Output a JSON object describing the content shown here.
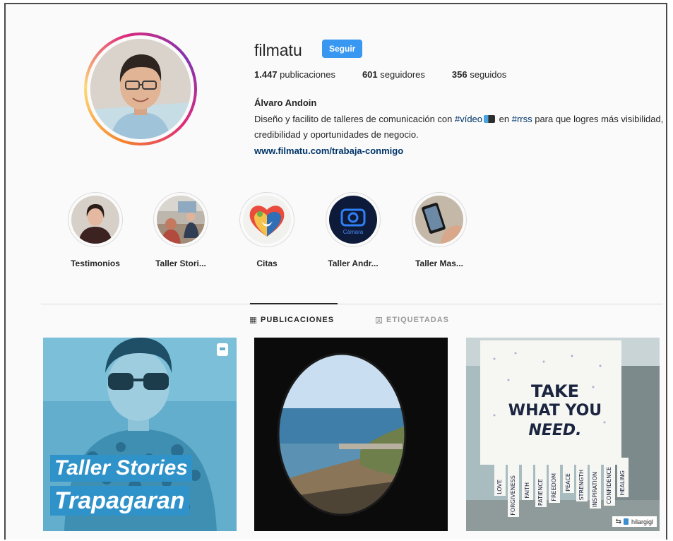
{
  "profile": {
    "username": "filmatu",
    "follow_label": "Seguir",
    "stats": {
      "posts_count": "1.447",
      "posts_label": "publicaciones",
      "followers_count": "601",
      "followers_label": "seguidores",
      "following_count": "356",
      "following_label": "seguidos"
    },
    "full_name": "Álvaro Andoin",
    "bio": {
      "part1": "Diseño y facilito de talleres de comunicación con ",
      "hashtag1": "#vídeo",
      "part2": " en ",
      "hashtag2": "#rrss",
      "part3": " para que logres más visibilidad, credibilidad y oportunidades de negocio."
    },
    "website": "www.filmatu.com/trabaja-conmigo"
  },
  "highlights": [
    {
      "label": "Testimonios"
    },
    {
      "label": "Taller Stori..."
    },
    {
      "label": "Citas"
    },
    {
      "label": "Taller Andr..."
    },
    {
      "label": "Taller Mas..."
    }
  ],
  "tabs": {
    "publicaciones": "PUBLICACIONES",
    "etiquetadas": "ETIQUETADAS"
  },
  "posts": [
    {
      "overlay_line1": "Taller Stories",
      "overlay_line2": "Trapagaran"
    },
    {},
    {
      "sign_line1": "TAKE",
      "sign_line2": "WHAT YOU",
      "sign_line3": "NEED.",
      "strips": [
        "LOVE",
        "FORGIVENESS",
        "FAITH",
        "PATIENCE",
        "FREEDOM",
        "PEACE",
        "STRENGTH",
        "INSPIRATION",
        "CONFIDENCE",
        "HEALING"
      ],
      "credit": "hilargigl"
    }
  ],
  "highlight_hl4_text": "Cámara",
  "colors": {
    "follow_button": "#3897f0",
    "link": "#003569",
    "avatar_ring": [
      "#f58529",
      "#dd2a7b",
      "#8134af"
    ]
  }
}
